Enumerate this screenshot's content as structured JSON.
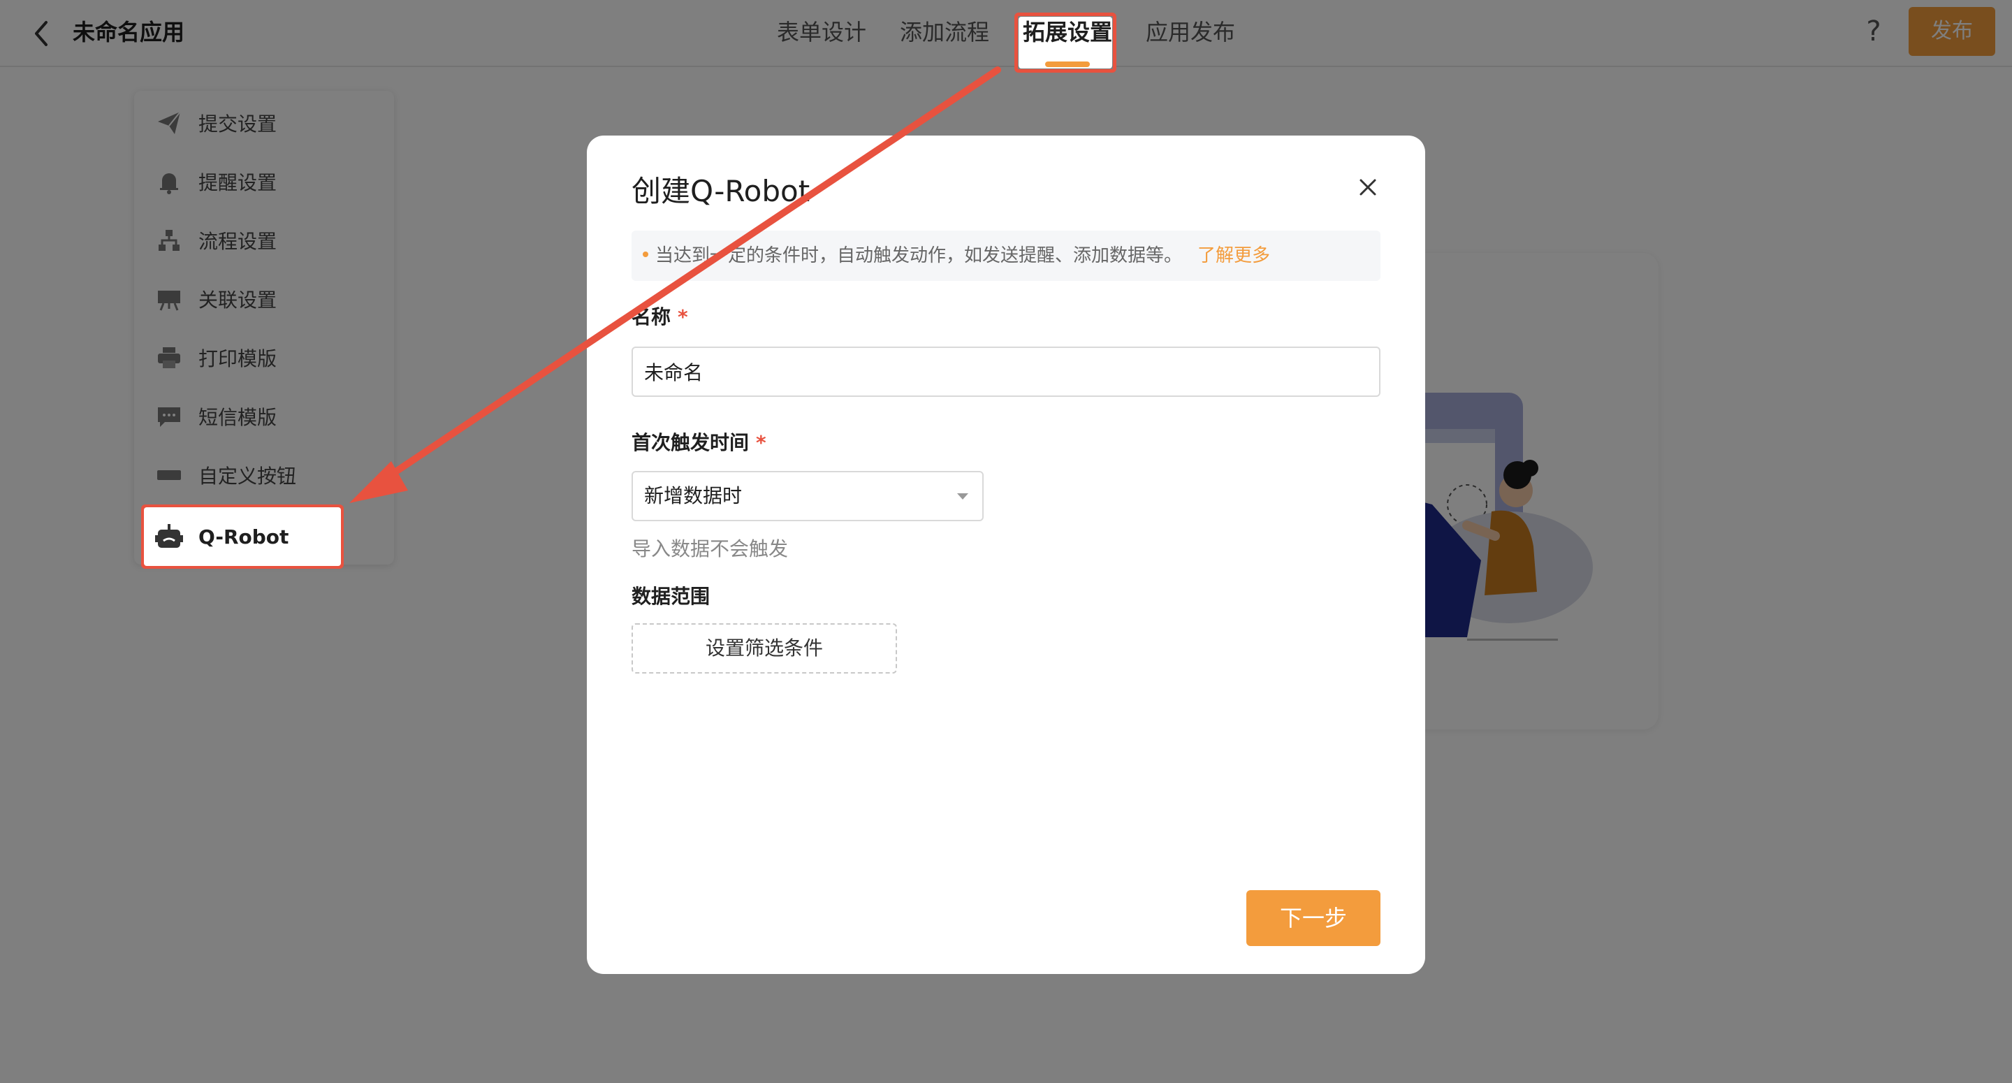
{
  "header": {
    "app_title": "未命名应用",
    "tabs": [
      {
        "label": "表单设计"
      },
      {
        "label": "添加流程"
      },
      {
        "label": "拓展设置"
      },
      {
        "label": "应用发布"
      }
    ],
    "help_glyph": "?",
    "publish_label": "发布"
  },
  "sidebar": {
    "items": [
      {
        "label": "提交设置",
        "icon": "paper-plane-icon"
      },
      {
        "label": "提醒设置",
        "icon": "bell-icon"
      },
      {
        "label": "流程设置",
        "icon": "flow-icon"
      },
      {
        "label": "关联设置",
        "icon": "link-board-icon"
      },
      {
        "label": "打印模版",
        "icon": "printer-icon"
      },
      {
        "label": "短信模版",
        "icon": "message-icon"
      },
      {
        "label": "自定义按钮",
        "icon": "custom-button-icon"
      },
      {
        "label": "Q-Robot",
        "icon": "robot-icon"
      }
    ]
  },
  "modal": {
    "title": "创建Q-Robot",
    "info_text": "当达到一定的条件时，自动触发动作，如发送提醒、添加数据等。",
    "info_link": "了解更多",
    "name_label": "名称",
    "name_value": "未命名",
    "required_mark": "*",
    "trigger_label": "首次触发时间",
    "trigger_value": "新增数据时",
    "trigger_hint": "导入数据不会触发",
    "range_label": "数据范围",
    "filter_button": "设置筛选条件",
    "next_button": "下一步"
  },
  "colors": {
    "accent": "#f39c3d",
    "annotation": "#e8523f",
    "mask": "rgba(0,0,0,0.5)"
  }
}
